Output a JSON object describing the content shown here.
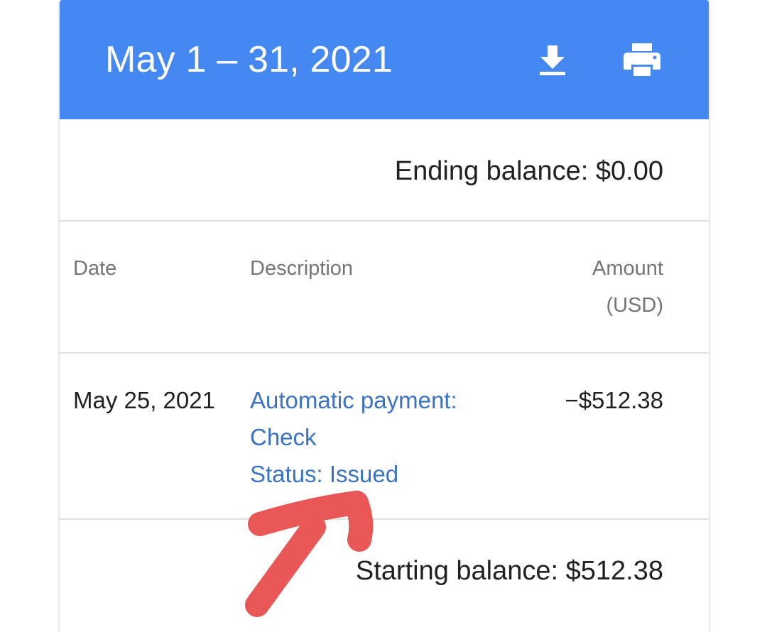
{
  "header": {
    "title": "May 1 – 31, 2021",
    "download_icon": "download-icon",
    "print_icon": "print-icon",
    "background_color": "#4688f1"
  },
  "summary": {
    "ending_balance": "Ending balance: $0.00",
    "starting_balance": "Starting balance: $512.38"
  },
  "table": {
    "columns": {
      "date": "Date",
      "description": "Description",
      "amount_line1": "Amount",
      "amount_line2": "(USD)"
    },
    "rows": [
      {
        "date": "May 25, 2021",
        "description_line1": "Automatic payment:",
        "description_line2": "Check",
        "description_line3": "Status: Issued",
        "amount": "−$512.38"
      }
    ]
  },
  "colors": {
    "link": "#3b73c2",
    "annotation": "#e85656"
  }
}
